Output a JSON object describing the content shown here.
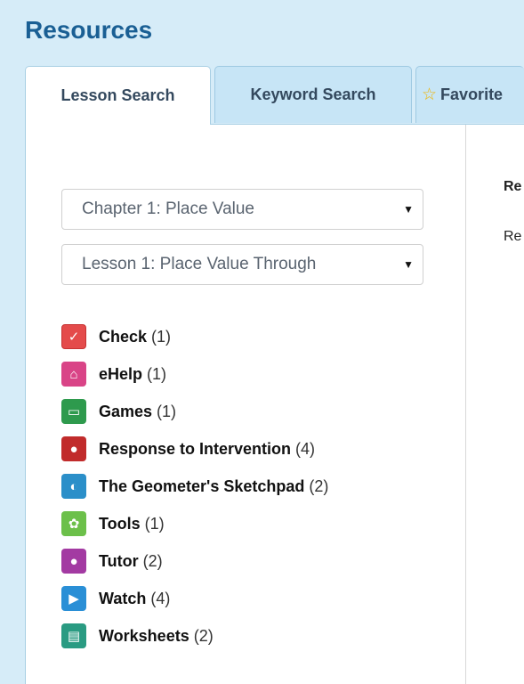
{
  "page": {
    "title": "Resources"
  },
  "tabs": [
    {
      "label": "Lesson Search",
      "active": true
    },
    {
      "label": "Keyword Search",
      "active": false
    },
    {
      "label": "Favorite",
      "active": false,
      "icon": "star-icon"
    }
  ],
  "filters": {
    "chapter": "Chapter 1: Place Value",
    "lesson": "Lesson 1: Place Value Through"
  },
  "resources": [
    {
      "label": "Check",
      "count": "(1)",
      "icon": "check-icon"
    },
    {
      "label": "eHelp",
      "count": "(1)",
      "icon": "ehelp-icon"
    },
    {
      "label": "Games",
      "count": "(1)",
      "icon": "games-icon"
    },
    {
      "label": "Response to Intervention",
      "count": "(4)",
      "icon": "rti-icon"
    },
    {
      "label": "The Geometer's Sketchpad",
      "count": "(2)",
      "icon": "sketchpad-icon"
    },
    {
      "label": "Tools",
      "count": "(1)",
      "icon": "tools-icon"
    },
    {
      "label": "Tutor",
      "count": "(2)",
      "icon": "tutor-icon"
    },
    {
      "label": "Watch",
      "count": "(4)",
      "icon": "watch-icon"
    },
    {
      "label": "Worksheets",
      "count": "(2)",
      "icon": "worksheets-icon"
    }
  ],
  "right_panel": {
    "label_1": "Re",
    "label_2": "Re"
  },
  "colors": {
    "background": "#d6ecf8",
    "title": "#1a5f94",
    "tab_inactive": "#c7e5f6"
  }
}
